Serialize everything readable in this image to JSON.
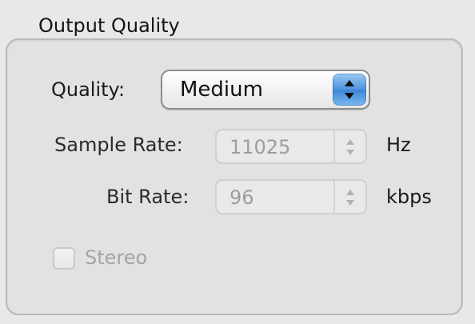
{
  "group": {
    "title": "Output Quality"
  },
  "quality": {
    "label": "Quality:",
    "value": "Medium",
    "icon": "updown-arrows-icon",
    "accent": "#4d93dc"
  },
  "sample_rate": {
    "label": "Sample Rate:",
    "value": "11025",
    "unit": "Hz",
    "enabled": false
  },
  "bit_rate": {
    "label": "Bit Rate:",
    "value": "96",
    "unit": "kbps",
    "enabled": false
  },
  "stereo": {
    "label": "Stereo",
    "checked": false,
    "enabled": false
  }
}
